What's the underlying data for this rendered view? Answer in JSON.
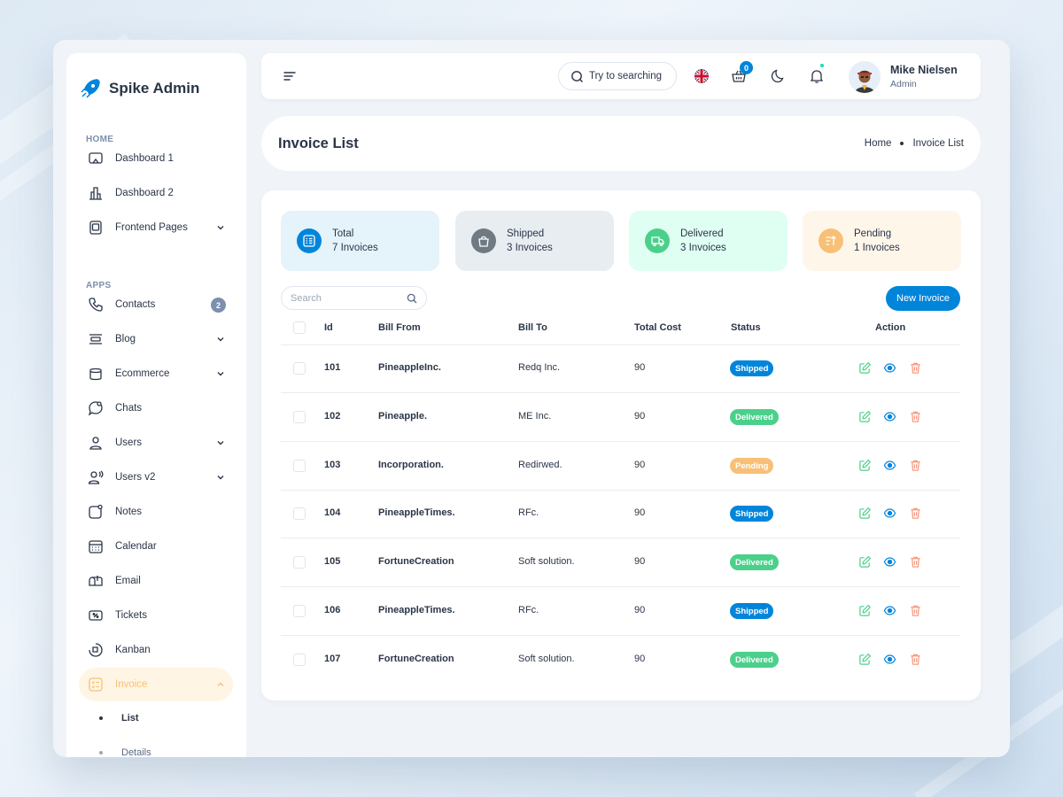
{
  "brand": {
    "name": "Spike Admin"
  },
  "sidebar": {
    "sections": [
      {
        "caption": "HOME"
      },
      {
        "caption": "APPS"
      }
    ],
    "items": [
      {
        "label": "Dashboard 1",
        "icon": "monitor-icon"
      },
      {
        "label": "Dashboard 2",
        "icon": "building-icon"
      },
      {
        "label": "Frontend Pages",
        "icon": "page-icon"
      },
      {
        "label": "Contacts",
        "icon": "phone-icon",
        "badge": "2"
      },
      {
        "label": "Blog",
        "icon": "blog-icon"
      },
      {
        "label": "Ecommerce",
        "icon": "basket-icon"
      },
      {
        "label": "Chats",
        "icon": "chat-icon"
      },
      {
        "label": "Users",
        "icon": "user-icon"
      },
      {
        "label": "Users v2",
        "icon": "users-icon"
      },
      {
        "label": "Notes",
        "icon": "notes-icon"
      },
      {
        "label": "Calendar",
        "icon": "calendar-icon"
      },
      {
        "label": "Email",
        "icon": "mailbox-icon"
      },
      {
        "label": "Tickets",
        "icon": "ticket-icon"
      },
      {
        "label": "Kanban",
        "icon": "kanban-icon"
      },
      {
        "label": "Invoice",
        "icon": "invoice-icon"
      }
    ],
    "subitems": [
      {
        "label": "List"
      },
      {
        "label": "Details"
      }
    ]
  },
  "topbar": {
    "search_placeholder": "Try to searching",
    "cart_count": "0",
    "user_name": "Mike Nielsen",
    "user_role": "Admin"
  },
  "page": {
    "title": "Invoice List",
    "breadcrumbs": [
      "Home",
      "Invoice List"
    ]
  },
  "stats": [
    {
      "label": "Total",
      "count": "7 Invoices",
      "bg": "#e5f3fb",
      "icon_bg": "#0085db",
      "icon": "list-icon"
    },
    {
      "label": "Shipped",
      "count": "3 Invoices",
      "bg": "#e8edf2",
      "icon_bg": "#707a82",
      "icon": "bag-icon"
    },
    {
      "label": "Delivered",
      "count": "3 Invoices",
      "bg": "#dffff3",
      "icon_bg": "#4bd08b",
      "icon": "truck-icon"
    },
    {
      "label": "Pending",
      "count": "1 Invoices",
      "bg": "#fff6ea",
      "icon_bg": "#f8c076",
      "icon": "sort-icon"
    }
  ],
  "table": {
    "search_placeholder": "Search",
    "new_button": "New Invoice",
    "headers": [
      "Id",
      "Bill From",
      "Bill To",
      "Total Cost",
      "Status",
      "Action"
    ],
    "rows": [
      {
        "id": "101",
        "from": "PineappleInc.",
        "to": "Redq Inc.",
        "cost": "90",
        "status": "Shipped"
      },
      {
        "id": "102",
        "from": "Pineapple.",
        "to": "ME Inc.",
        "cost": "90",
        "status": "Delivered"
      },
      {
        "id": "103",
        "from": "Incorporation.",
        "to": "Redirwed.",
        "cost": "90",
        "status": "Pending"
      },
      {
        "id": "104",
        "from": "PineappleTimes.",
        "to": "RFc.",
        "cost": "90",
        "status": "Shipped"
      },
      {
        "id": "105",
        "from": "FortuneCreation",
        "to": "Soft solution.",
        "cost": "90",
        "status": "Delivered"
      },
      {
        "id": "106",
        "from": "PineappleTimes.",
        "to": "RFc.",
        "cost": "90",
        "status": "Shipped"
      },
      {
        "id": "107",
        "from": "FortuneCreation",
        "to": "Soft solution.",
        "cost": "90",
        "status": "Delivered"
      }
    ]
  },
  "status_colors": {
    "Shipped": "#0085db",
    "Delivered": "#4bd08b",
    "Pending": "#f8c076"
  },
  "colors": {
    "primary": "#0085db",
    "edit": "#4bd08b",
    "view": "#0085db",
    "delete": "#fb977d",
    "active_nav": "#f8c076"
  }
}
